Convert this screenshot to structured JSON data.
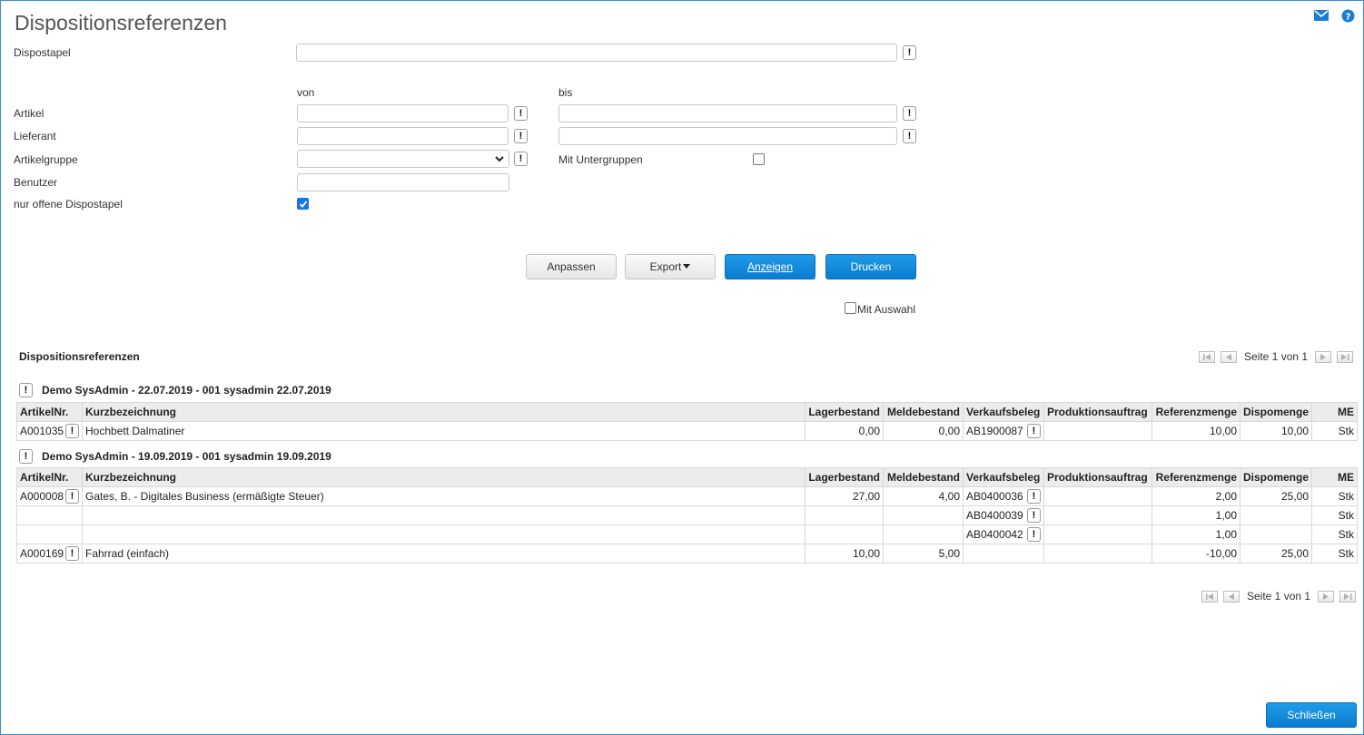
{
  "header": {
    "title": "Dispositionsreferenzen",
    "icons": [
      "mail-icon",
      "help-icon"
    ]
  },
  "filters": {
    "dispostapel_label": "Dispostapel",
    "dispostapel_value": "",
    "von_label": "von",
    "bis_label": "bis",
    "artikel_label": "Artikel",
    "lieferant_label": "Lieferant",
    "artikelgruppe_label": "Artikelgruppe",
    "mit_untergruppen_label": "Mit Untergruppen",
    "mit_untergruppen_checked": false,
    "benutzer_label": "Benutzer",
    "nur_offene_label": "nur offene Dispostapel",
    "nur_offene_checked": true,
    "info_glyph": "!"
  },
  "actions": {
    "anpassen": "Anpassen",
    "export": "Export",
    "anzeigen": "Anzeigen",
    "drucken": "Drucken",
    "mit_auswahl": "Mit Auswahl",
    "mit_auswahl_checked": false,
    "schliessen": "Schließen"
  },
  "results": {
    "title": "Dispositionsreferenzen",
    "pager_text": "Seite 1 von 1",
    "columns": [
      "ArtikelNr.",
      "Kurzbezeichnung",
      "Lagerbestand",
      "Meldebestand",
      "Verkaufsbeleg",
      "Produktionsauftrag",
      "Referenzmenge",
      "Dispomenge",
      "ME"
    ],
    "groups": [
      {
        "title": "Demo SysAdmin - 22.07.2019 - 001 sysadmin 22.07.2019",
        "rows": [
          {
            "artikelnr": "A001035",
            "kurz": "Hochbett Dalmatiner",
            "lager": "0,00",
            "melde": "0,00",
            "vk": "AB1900087",
            "prod": "",
            "ref": "10,00",
            "dispo": "10,00",
            "me": "Stk"
          }
        ]
      },
      {
        "title": "Demo SysAdmin - 19.09.2019 - 001 sysadmin 19.09.2019",
        "rows": [
          {
            "artikelnr": "A000008",
            "kurz": "Gates, B. - Digitales Business (ermäßigte Steuer)",
            "lager": "27,00",
            "melde": "4,00",
            "vk": "AB0400036",
            "prod": "",
            "ref": "2,00",
            "dispo": "25,00",
            "me": "Stk"
          },
          {
            "artikelnr": "",
            "kurz": "",
            "lager": "",
            "melde": "",
            "vk": "AB0400039",
            "prod": "",
            "ref": "1,00",
            "dispo": "",
            "me": "Stk"
          },
          {
            "artikelnr": "",
            "kurz": "",
            "lager": "",
            "melde": "",
            "vk": "AB0400042",
            "prod": "",
            "ref": "1,00",
            "dispo": "",
            "me": "Stk"
          },
          {
            "artikelnr": "A000169",
            "kurz": "Fahrrad (einfach)",
            "lager": "10,00",
            "melde": "5,00",
            "vk": "",
            "prod": "",
            "ref": "-10,00",
            "dispo": "25,00",
            "me": "Stk"
          }
        ]
      }
    ]
  }
}
